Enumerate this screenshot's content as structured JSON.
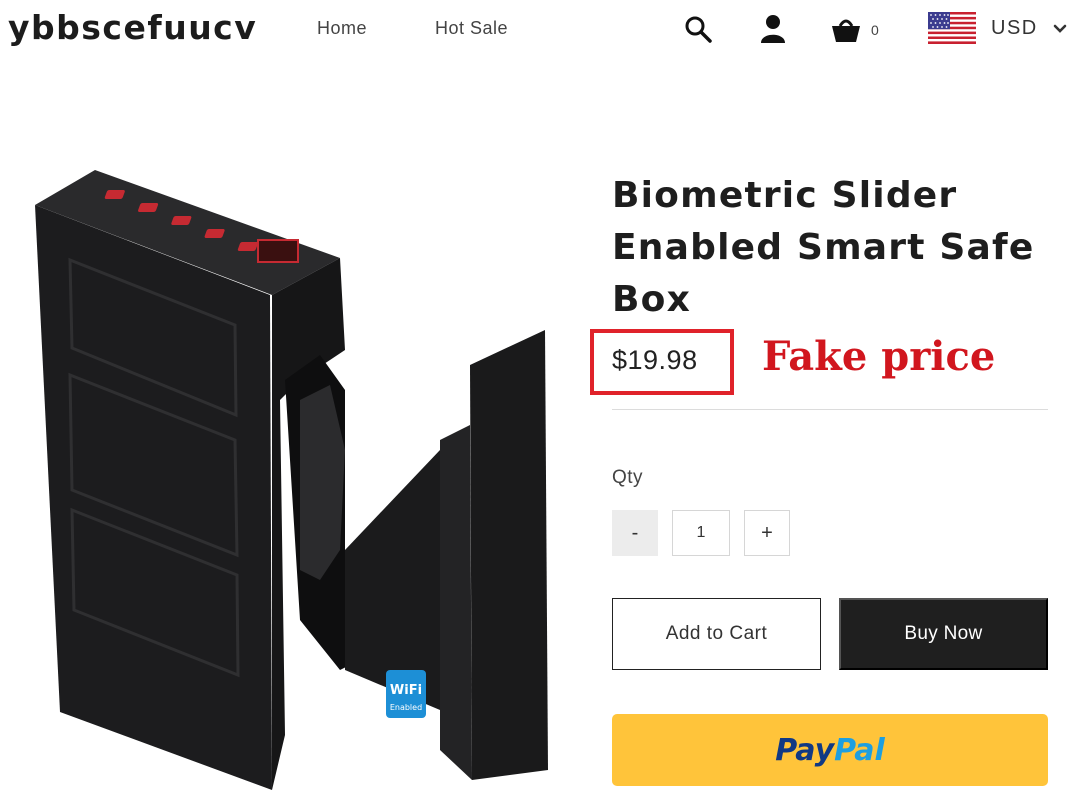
{
  "header": {
    "brand": "ybbscefuucv",
    "nav": [
      {
        "label": "Home"
      },
      {
        "label": "Hot Sale"
      }
    ],
    "icons": [
      "search-icon",
      "user-icon",
      "cart-icon",
      "us-flag-icon",
      "chevron-down-icon"
    ],
    "cart_count": "0",
    "currency": "USD"
  },
  "product": {
    "title": "Biometric Slider Enabled Smart Safe Box",
    "price": "$19.98",
    "annotation": "Fake price",
    "qty_label": "Qty",
    "qty_value": "1",
    "minus_label": "-",
    "plus_label": "+",
    "add_to_cart": "Add to Cart",
    "buy_now": "Buy Now",
    "paypal_part1": "Pay",
    "paypal_part2": "Pal",
    "image": {
      "badge_line1": "WiFi",
      "badge_line2": "Enabled"
    }
  },
  "colors": {
    "annotation_red": "#e0222a",
    "buy_now_bg": "#1f1f1f",
    "paypal_yellow": "#ffc43a",
    "paypal_dark_blue": "#113984",
    "paypal_light_blue": "#1e9fe0"
  }
}
